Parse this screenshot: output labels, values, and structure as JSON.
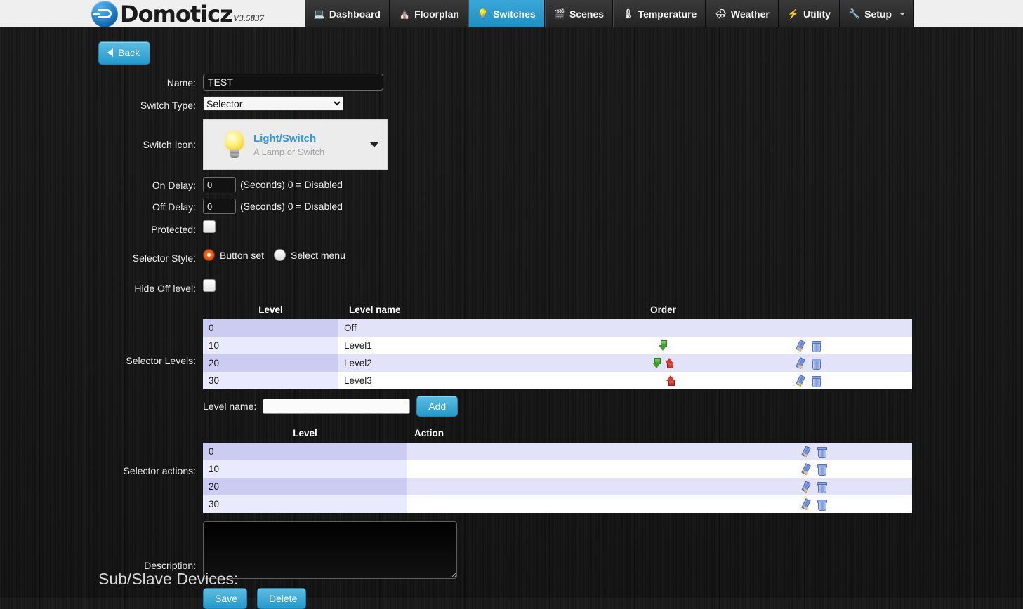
{
  "brand": {
    "name": "Domoticz",
    "version": "V3.5837",
    "logo_icon": "domoticz-logo-icon"
  },
  "nav": {
    "items": [
      {
        "label": "Dashboard",
        "icon": "dashboard-icon",
        "glyph": "🖥",
        "active": false
      },
      {
        "label": "Floorplan",
        "icon": "floorplan-icon",
        "glyph": "⛭",
        "active": false
      },
      {
        "label": "Switches",
        "icon": "lightbulb-icon",
        "glyph": "💡",
        "active": true
      },
      {
        "label": "Scenes",
        "icon": "clapper-icon",
        "glyph": "🎬",
        "active": false
      },
      {
        "label": "Temperature",
        "icon": "thermometer-icon",
        "glyph": "🌡",
        "active": false
      },
      {
        "label": "Weather",
        "icon": "cloud-rain-icon",
        "glyph": "🌧",
        "active": false
      },
      {
        "label": "Utility",
        "icon": "lightning-icon",
        "glyph": "⚡",
        "active": false
      },
      {
        "label": "Setup",
        "icon": "tools-icon",
        "glyph": "🛠",
        "active": false,
        "has_caret": true
      }
    ]
  },
  "toolbar": {
    "back_label": "Back",
    "back_icon": "arrow-left-icon"
  },
  "form": {
    "name_label": "Name:",
    "name_value": "TEST",
    "switch_type_label": "Switch Type:",
    "switch_type_value": "Selector",
    "switch_type_options": [
      "Selector"
    ],
    "switch_icon_label": "Switch Icon:",
    "switch_icon_title": "Light/Switch",
    "switch_icon_subtitle": "A Lamp or Switch",
    "switch_icon_glyph": "lightbulb-icon",
    "on_delay_label": "On Delay:",
    "on_delay_value": "0",
    "on_delay_hint": "(Seconds) 0 = Disabled",
    "off_delay_label": "Off Delay:",
    "off_delay_value": "0",
    "off_delay_hint": "(Seconds) 0 = Disabled",
    "protected_label": "Protected:",
    "protected_checked": false,
    "selector_style_label": "Selector Style:",
    "selector_style_options": [
      {
        "label": "Button set",
        "selected": true
      },
      {
        "label": "Select menu",
        "selected": false
      }
    ],
    "hide_off_label": "Hide Off level:",
    "hide_off_checked": false,
    "description_label": "Description:",
    "description_value": "",
    "save_label": "Save",
    "delete_label": "Delete"
  },
  "selector_levels": {
    "label": "Selector Levels:",
    "headers": {
      "level": "Level",
      "level_name": "Level name",
      "order": "Order"
    },
    "rows": [
      {
        "level": "0",
        "name": "Off",
        "can_down": false,
        "can_up": false,
        "has_actions": false
      },
      {
        "level": "10",
        "name": "Level1",
        "can_down": true,
        "can_up": false,
        "has_actions": true
      },
      {
        "level": "20",
        "name": "Level2",
        "can_down": true,
        "can_up": true,
        "has_actions": true
      },
      {
        "level": "30",
        "name": "Level3",
        "can_down": false,
        "can_up": true,
        "has_actions": true
      }
    ],
    "add_label": "Level name:",
    "add_value": "",
    "add_button": "Add"
  },
  "selector_actions": {
    "label": "Selector actions:",
    "headers": {
      "level": "Level",
      "action": "Action"
    },
    "rows": [
      {
        "level": "0",
        "action": ""
      },
      {
        "level": "10",
        "action": ""
      },
      {
        "level": "20",
        "action": ""
      },
      {
        "level": "30",
        "action": ""
      }
    ]
  },
  "sub_devices": {
    "heading": "Sub/Slave Devices:"
  },
  "colors": {
    "accent_blue": "#2499cc",
    "nav_active": "#2e9fd0",
    "row_dark": "#ccccf2",
    "row_light": "#eaeaff",
    "radio_on": "#d9541b",
    "icon_title": "#3399dd"
  }
}
